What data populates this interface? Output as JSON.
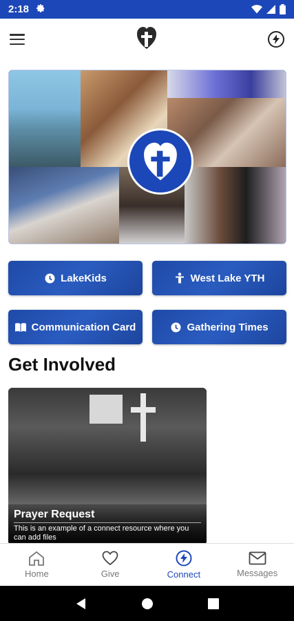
{
  "status": {
    "time": "2:18"
  },
  "header": {
    "logo": "heart-cross-logo",
    "menu_icon": "hamburger-icon",
    "action_icon": "bolt-circle-icon"
  },
  "hero": {
    "alt": "church-photo-collage"
  },
  "buttons": [
    {
      "label": "LakeKids",
      "icon": "clock-icon"
    },
    {
      "label": "West Lake YTH",
      "icon": "person-icon"
    },
    {
      "label": "Communication Card",
      "icon": "book-icon"
    },
    {
      "label": "Gathering Times",
      "icon": "clock-icon"
    }
  ],
  "section": {
    "title": "Get Involved"
  },
  "card": {
    "title": "Prayer Request",
    "description": "This is an example of a connect resource where you can add files"
  },
  "nav": [
    {
      "label": "Home",
      "icon": "home-icon"
    },
    {
      "label": "Give",
      "icon": "heart-icon"
    },
    {
      "label": "Connect",
      "icon": "bolt-circle-icon",
      "active": true
    },
    {
      "label": "Messages",
      "icon": "mail-icon"
    }
  ],
  "colors": {
    "brand": "#1c47b8",
    "button": "#2a5cc0",
    "inactive": "#777777"
  }
}
